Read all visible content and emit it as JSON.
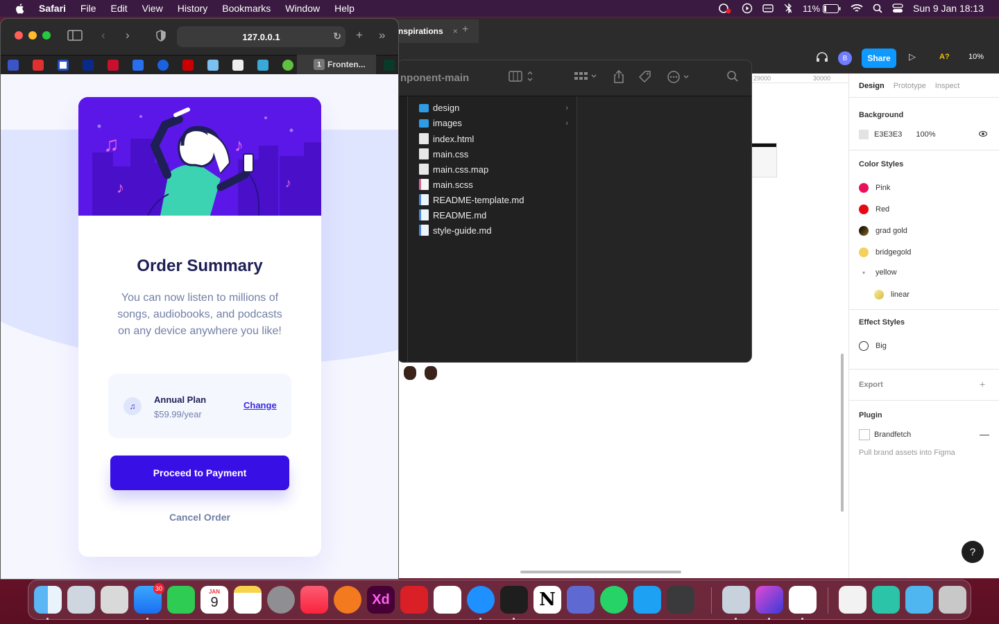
{
  "menubar": {
    "items": [
      "Safari",
      "File",
      "Edit",
      "View",
      "History",
      "Bookmarks",
      "Window",
      "Help"
    ],
    "battery": "11%",
    "datetime": "Sun 9 Jan  18:13"
  },
  "safari": {
    "url": "127.0.0.1",
    "tab_count": "1",
    "tab_title": "Fronten..."
  },
  "card": {
    "title": "Order Summary",
    "description": "You can now listen to millions of songs, audiobooks, and podcasts on any device anywhere you like!",
    "plan_name": "Annual Plan",
    "plan_price": "$59.99/year",
    "change_label": "Change",
    "pay_label": "Proceed to Payment",
    "cancel_label": "Cancel Order",
    "colors": {
      "primary": "#3810e6",
      "dark": "#1e1f55",
      "muted": "#717fa6",
      "bg": "#e0e6ff"
    }
  },
  "finder": {
    "title": "nponent-main",
    "items": [
      {
        "name": "design",
        "type": "folder"
      },
      {
        "name": "images",
        "type": "folder"
      },
      {
        "name": "index.html",
        "type": "file"
      },
      {
        "name": "main.css",
        "type": "file"
      },
      {
        "name": "main.css.map",
        "type": "file"
      },
      {
        "name": "main.scss",
        "type": "file"
      },
      {
        "name": "README-template.md",
        "type": "file"
      },
      {
        "name": "README.md",
        "type": "file"
      },
      {
        "name": "style-guide.md",
        "type": "file"
      }
    ]
  },
  "figma": {
    "tab_title": "nspirations",
    "avatar_initial": "B",
    "share_label": "Share",
    "a11y": "A?",
    "zoom": "10%",
    "ruler": [
      "29000",
      "30000"
    ],
    "panel_tabs": [
      "Design",
      "Prototype",
      "Inspect"
    ],
    "background_label": "Background",
    "background_hex": "E3E3E3",
    "background_opacity": "100%",
    "color_styles_label": "Color Styles",
    "color_styles": [
      {
        "name": "Pink",
        "color": "#e8125c"
      },
      {
        "name": "Red",
        "color": "#e50914"
      },
      {
        "name": "grad gold",
        "color": "#3a2a10"
      },
      {
        "name": "bridgegold",
        "color": "#f3d15c"
      },
      {
        "name": "yellow"
      },
      {
        "name": "linear",
        "color": "#f1e38a"
      }
    ],
    "effect_styles_label": "Effect Styles",
    "effect_style": "Big",
    "export_label": "Export",
    "plugin_label": "Plugin",
    "plugin_name": "Brandfetch",
    "plugin_desc": "Pull brand assets into Figma"
  },
  "dock": {
    "apps": [
      "Finder",
      "Launchpad",
      "Screenshot",
      "Mail",
      "FaceTime",
      "Calendar",
      "Notes",
      "System Preferences",
      "Music",
      "Infuse",
      "Adobe XD",
      "Creative Cloud",
      "Slack",
      "Safari",
      "Figma",
      "Notion",
      "Linear",
      "WhatsApp",
      "Twitter",
      "Calculator",
      "Preview",
      "Shortcuts",
      "VS Code",
      "HTML File",
      "Files",
      "Downloads",
      "Trash"
    ],
    "calendar_month": "JAN",
    "calendar_day": "9",
    "mail_badge": "30"
  }
}
